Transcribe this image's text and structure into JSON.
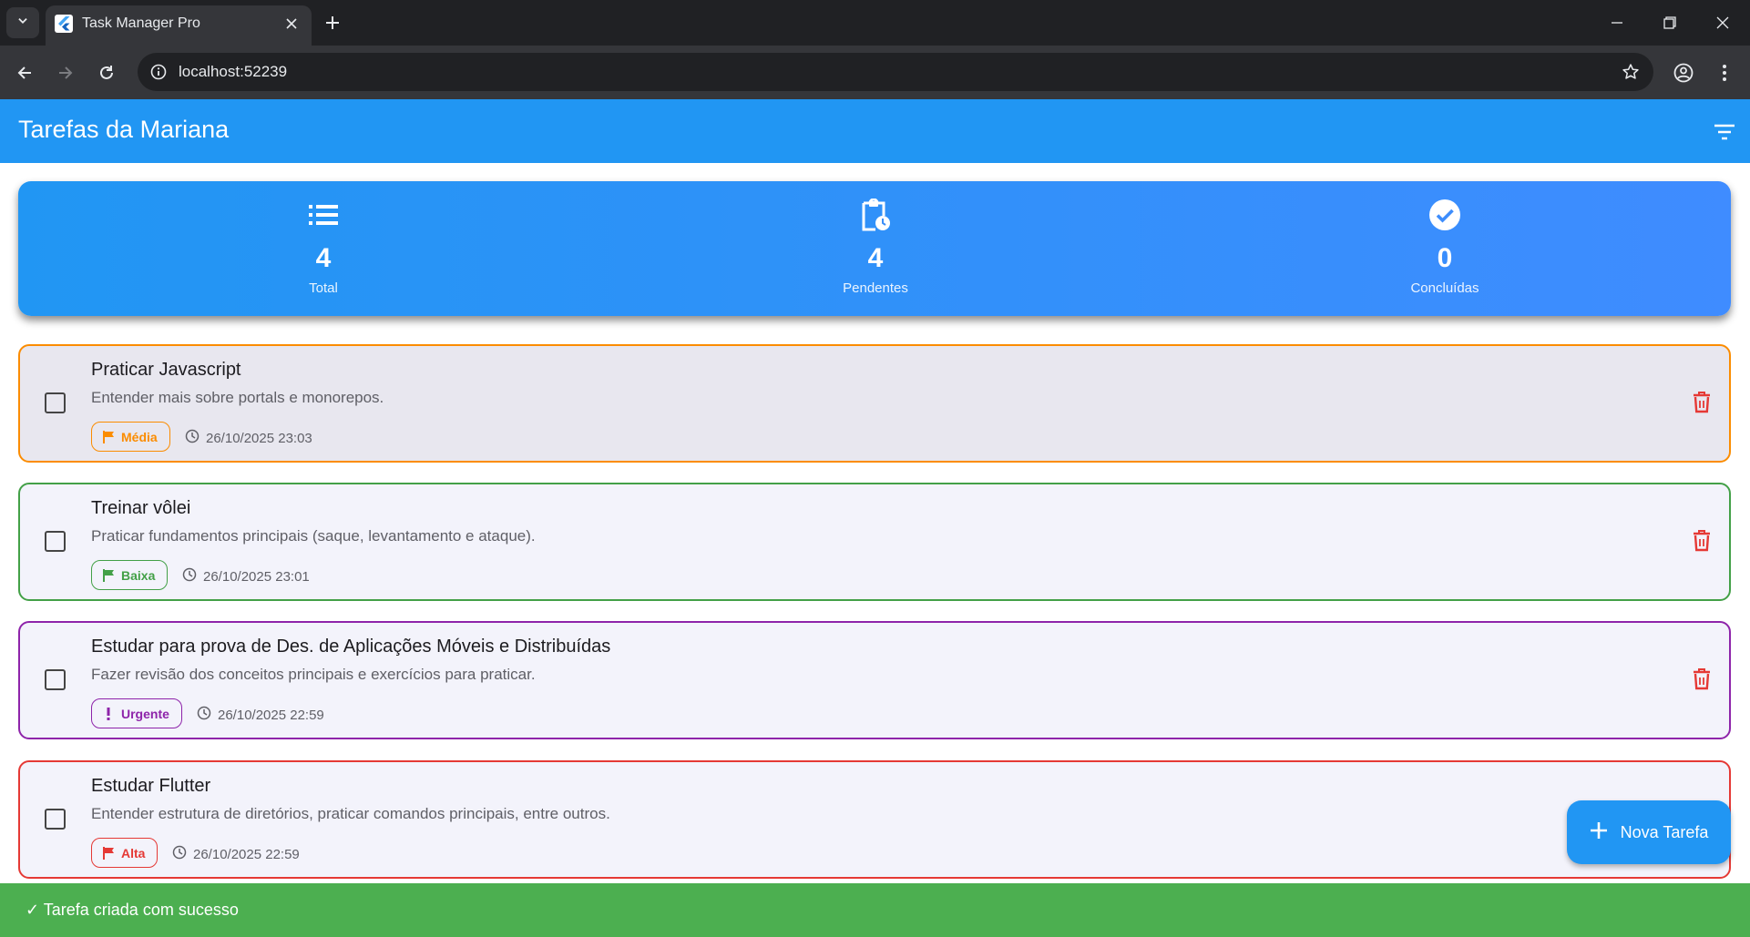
{
  "browser": {
    "tab_title": "Task Manager Pro",
    "url": "localhost:52239"
  },
  "appbar": {
    "title": "Tarefas da Mariana"
  },
  "stats": [
    {
      "icon": "list-icon",
      "value": "4",
      "label": "Total"
    },
    {
      "icon": "pending-clipboard-icon",
      "value": "4",
      "label": "Pendentes"
    },
    {
      "icon": "check-circle-icon",
      "value": "0",
      "label": "Concluídas"
    }
  ],
  "tasks": [
    {
      "title": "Praticar Javascript",
      "description": "Entender mais sobre portals e monorepos.",
      "priority": "Média",
      "priority_icon": "flag-icon",
      "color": "#fb8c00",
      "completed": false,
      "date": "26/10/2025 23:03"
    },
    {
      "title": "Treinar vôlei",
      "description": "Praticar fundamentos principais (saque, levantamento e ataque).",
      "priority": "Baixa",
      "priority_icon": "flag-icon",
      "color": "#43a047",
      "completed": false,
      "date": "26/10/2025 23:01"
    },
    {
      "title": "Estudar para prova de Des. de Aplicações Móveis e Distribuídas",
      "description": "Fazer revisão dos conceitos principais e exercícios para praticar.",
      "priority": "Urgente",
      "priority_icon": "exclamation-icon",
      "color": "#8e24aa",
      "completed": false,
      "date": "26/10/2025 22:59"
    },
    {
      "title": "Estudar Flutter",
      "description": "Entender estrutura de diretórios, praticar comandos principais, entre outros.",
      "priority": "Alta",
      "priority_icon": "flag-icon",
      "color": "#e53935",
      "completed": false,
      "date": "26/10/2025 22:59"
    }
  ],
  "fab": {
    "label": "Nova Tarefa"
  },
  "snackbar": {
    "message": "✓ Tarefa criada com sucesso"
  },
  "colors": {
    "primary": "#2196f3",
    "delete": "#e53935",
    "success": "#4caf50"
  }
}
